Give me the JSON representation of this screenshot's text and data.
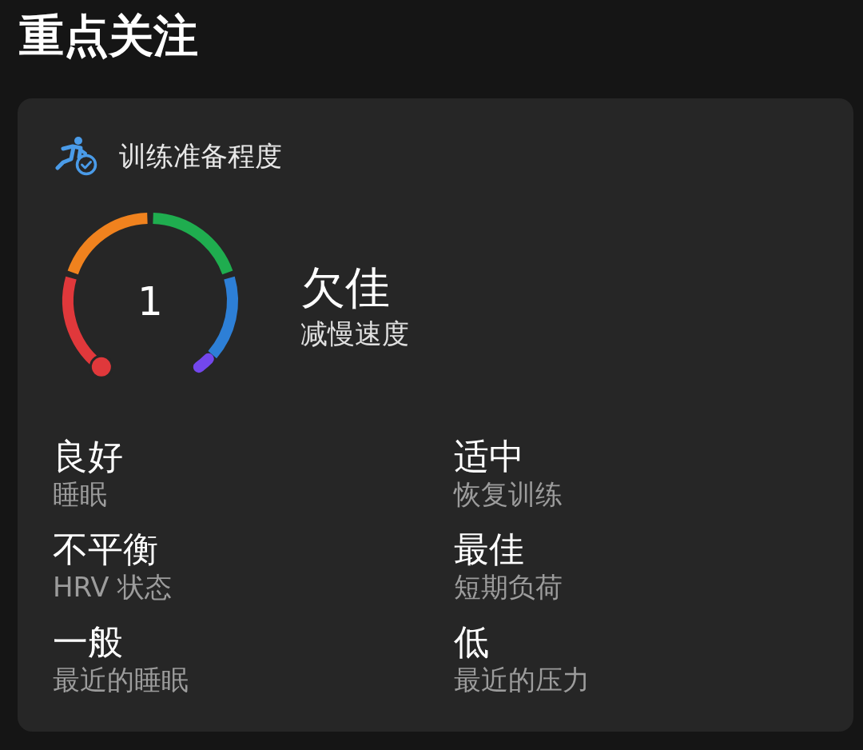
{
  "page": {
    "title": "重点关注"
  },
  "card": {
    "title": "训练准备程度",
    "gauge": {
      "reading": "1",
      "level": 0.01,
      "segments": [
        {
          "color": "#e0383b"
        },
        {
          "color": "#f0821e"
        },
        {
          "color": "#1fad4f"
        },
        {
          "color": "#2d7fd6"
        },
        {
          "color": "#7347ec"
        }
      ]
    },
    "status": {
      "value": "欠佳",
      "note": "减慢速度"
    },
    "factors": [
      {
        "value": "良好",
        "label": "睡眠"
      },
      {
        "value": "适中",
        "label": "恢复训练"
      },
      {
        "value": "不平衡",
        "label": "HRV 状态"
      },
      {
        "value": "最佳",
        "label": "短期负荷"
      },
      {
        "value": "一般",
        "label": "最近的睡眠"
      },
      {
        "value": "低",
        "label": "最近的压力"
      }
    ]
  }
}
